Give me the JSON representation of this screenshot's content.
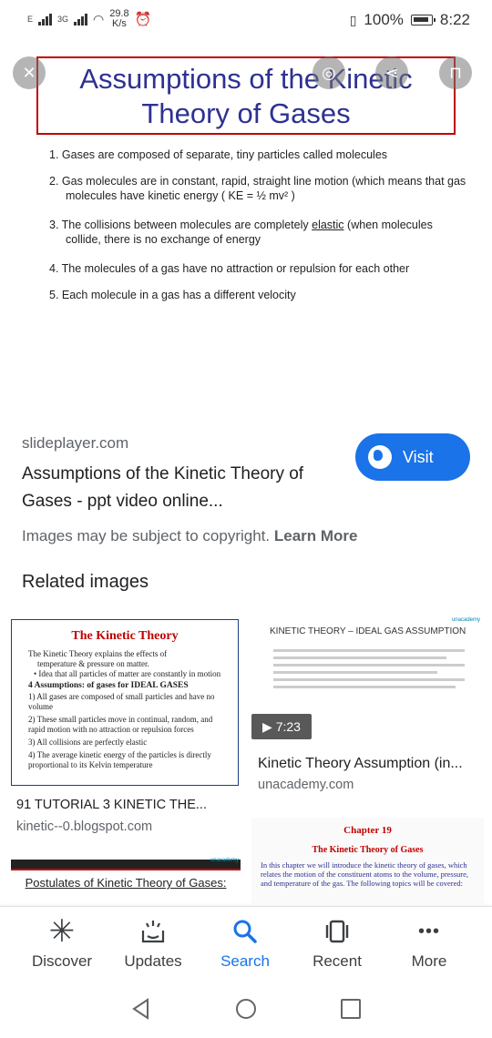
{
  "status": {
    "network_left": "E",
    "network_mid": "3G",
    "speed_value": "29.8",
    "speed_unit": "K/s",
    "battery": "100%",
    "time": "8:22"
  },
  "slide": {
    "title_line1": "Assumptions of the Kinetic",
    "title_line2": "Theory of Gases",
    "items": [
      "1. Gases are composed of separate, tiny particles called molecules",
      "2. Gas molecules are in constant, rapid, straight line motion (which means that gas molecules have kinetic energy ( KE = ½ mv² )",
      "3. The collisions between molecules are completely",
      "4. The molecules of a gas have no attraction or repulsion for each other",
      "5. Each molecule in a gas has a different velocity"
    ],
    "item3_underlined": "elastic",
    "item3_rest": "(when molecules collide, there is no exchange of energy"
  },
  "result": {
    "source": "slideplayer.com",
    "title": "Assumptions of the Kinetic Theory of Gases - ppt video online...",
    "visit_label": "Visit",
    "copyright_text": "Images may be subject to copyright.",
    "learn_more": "Learn More"
  },
  "related": {
    "heading": "Related images",
    "card_a": {
      "thumb_title": "The Kinetic Theory",
      "lines": [
        "The Kinetic Theory explains the effects of",
        "temperature & pressure on matter.",
        "• Idea that all particles of matter are constantly in motion"
      ],
      "bold_line": "4 Assumptions: of gases for IDEAL GASES",
      "points": [
        "1) All gases are composed of small particles and have no volume",
        "2) These small particles move in continual, random, and rapid motion with no attraction or repulsion forces",
        "3) All collisions are perfectly elastic",
        "4) The average kinetic energy of the particles is directly proportional to its Kelvin temperature"
      ],
      "caption": "91 TUTORIAL 3 KINETIC THE...",
      "source": "kinetic--0.blogspot.com"
    },
    "card_b": {
      "thumb_brand": "unacademy",
      "thumb_title": "KINETIC THEORY – IDEAL GAS ASSUMPTION",
      "duration": "▶ 7:23",
      "caption": "Kinetic Theory Assumption (in...",
      "source": "unacademy.com"
    },
    "card_c": {
      "thumb_brand": "unacademy",
      "thumb_title": "Postulates of Kinetic Theory of Gases:"
    },
    "card_d": {
      "h1": "Chapter 19",
      "h2": "The Kinetic Theory of Gases",
      "text": "In this chapter we will introduce the kinetic theory of gases, which relates the motion of the constituent atoms to the volume, pressure, and temperature of the gas. The following topics will be covered:"
    }
  },
  "bottom_nav": [
    {
      "label": "Discover",
      "icon": "asterisk-icon"
    },
    {
      "label": "Updates",
      "icon": "updates-icon"
    },
    {
      "label": "Search",
      "icon": "search-icon"
    },
    {
      "label": "Recent",
      "icon": "recent-icon"
    },
    {
      "label": "More",
      "icon": "more-icon"
    }
  ],
  "colors": {
    "accent": "#1a73e8",
    "slide_title": "#2e3192",
    "slide_border": "#c00000"
  }
}
